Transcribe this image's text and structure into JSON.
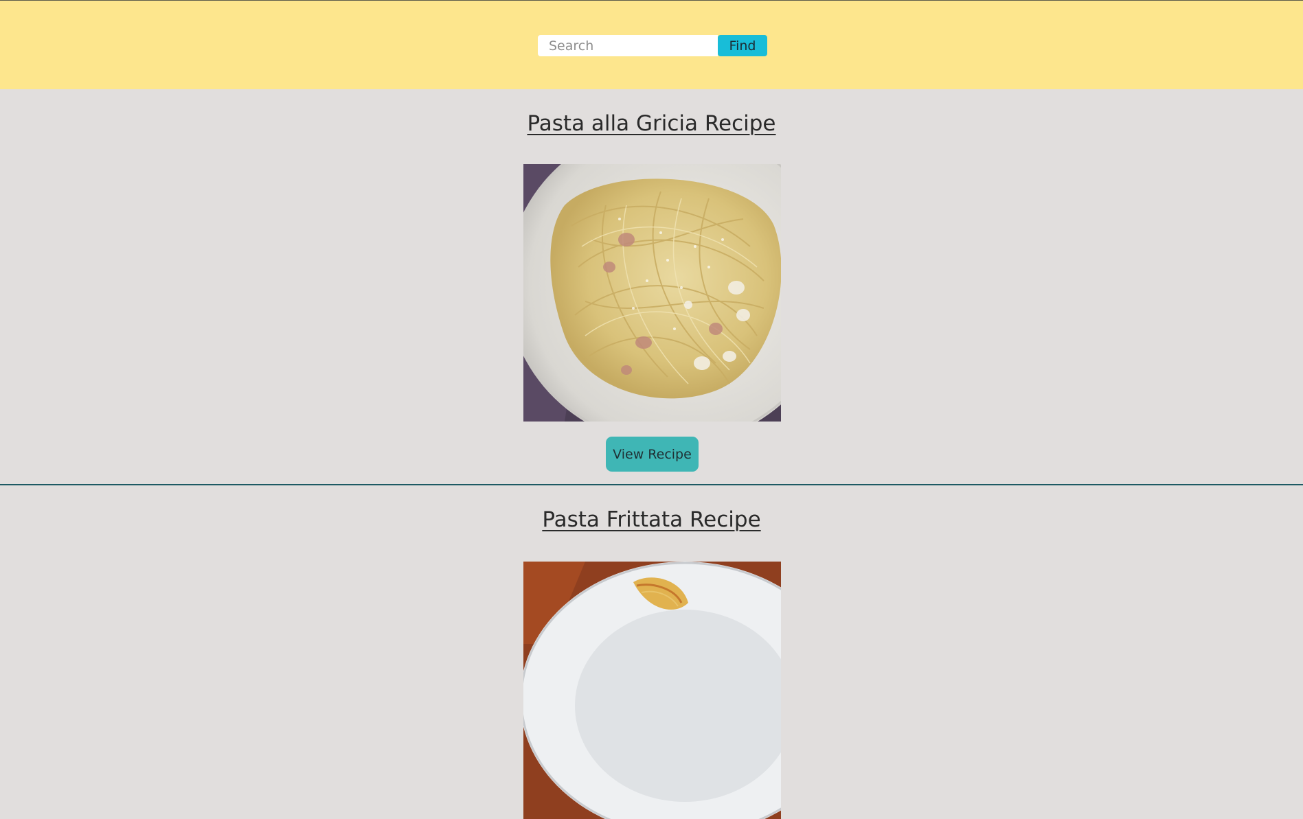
{
  "search": {
    "placeholder": "Search",
    "value": "",
    "button_label": "Find"
  },
  "recipes": [
    {
      "title": "Pasta alla Gricia Recipe",
      "button_label": "View Recipe"
    },
    {
      "title": "Pasta Frittata Recipe"
    }
  ],
  "colors": {
    "header_bg": "#fde68d",
    "page_bg": "#e1dedd",
    "find_button": "#18bdd8",
    "view_button": "#3fb6b5",
    "divider": "#1d5a63"
  }
}
